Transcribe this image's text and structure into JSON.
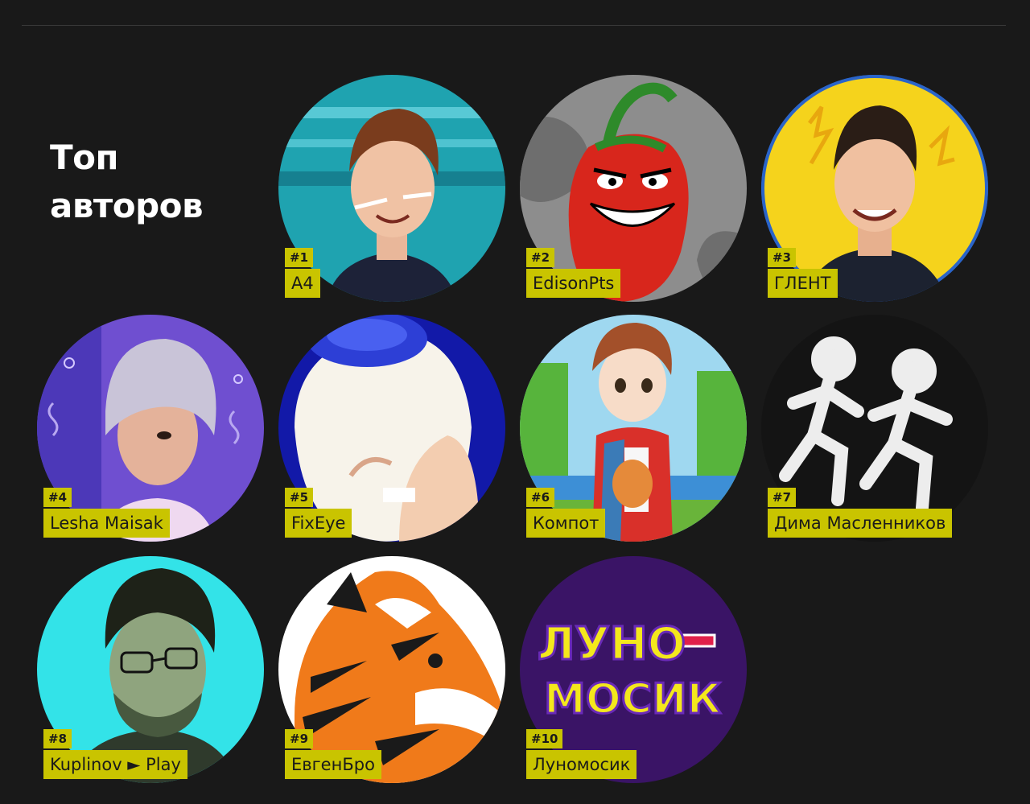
{
  "section": {
    "title_line1": "Топ",
    "title_line2": "авторов"
  },
  "authors": [
    {
      "rank": "#1",
      "name": "A4",
      "avatar_icon": "portrait-photo-icon",
      "colors": {
        "bg": "#1fa3b0",
        "accent": "#0e5d70"
      }
    },
    {
      "rank": "#2",
      "name": "EdisonPts",
      "avatar_icon": "chili-pepper-icon",
      "colors": {
        "bg": "#8d8d8d",
        "accent": "#d8261c"
      }
    },
    {
      "rank": "#3",
      "name": "ГЛЕНТ",
      "avatar_icon": "portrait-photo-icon",
      "colors": {
        "bg": "#f5d31c",
        "accent": "#2a64c9"
      }
    },
    {
      "rank": "#4",
      "name": "Lesha Maisak",
      "avatar_icon": "portrait-photo-icon",
      "colors": {
        "bg": "#6f4fd0",
        "accent": "#c9c4d8"
      }
    },
    {
      "rank": "#5",
      "name": "FixEye",
      "avatar_icon": "eyeball-icon",
      "colors": {
        "bg": "#1219a8",
        "accent": "#f7f3ea"
      }
    },
    {
      "rank": "#6",
      "name": "Компот",
      "avatar_icon": "cartoon-boy-icon",
      "colors": {
        "bg": "#57b43c",
        "accent": "#d9302a"
      }
    },
    {
      "rank": "#7",
      "name": "Дима Масленников",
      "avatar_icon": "running-figures-icon",
      "colors": {
        "bg": "#141414",
        "accent": "#ededed"
      }
    },
    {
      "rank": "#8",
      "name": "Kuplinov ► Play",
      "avatar_icon": "portrait-photo-icon",
      "colors": {
        "bg": "#33e3e8",
        "accent": "#48593f"
      }
    },
    {
      "rank": "#9",
      "name": "ЕвгенБро",
      "avatar_icon": "tiger-icon",
      "colors": {
        "bg": "#ffffff",
        "accent": "#f07a1a"
      }
    },
    {
      "rank": "#10",
      "name": "Луномосик",
      "avatar_icon": "luno-mosik-logo",
      "logo_text": [
        "ЛУНО",
        "МОСИК"
      ],
      "colors": {
        "bg": "#3a1466",
        "accent": "#f4e81c"
      }
    }
  ]
}
